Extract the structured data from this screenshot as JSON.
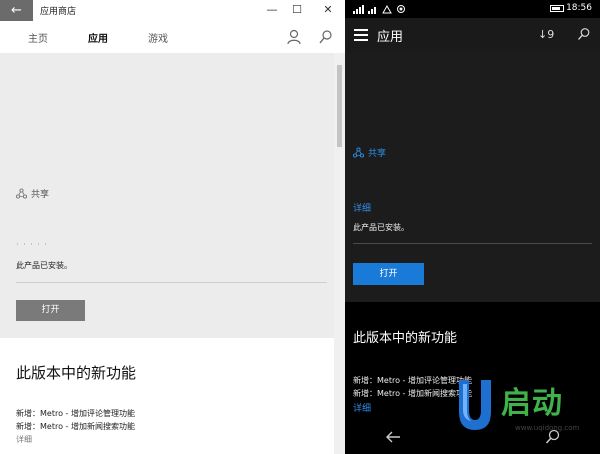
{
  "desktop": {
    "window_title": "应用商店",
    "controls": {
      "minimize": "—",
      "maximize": "☐",
      "close": "✕"
    },
    "nav_tabs": [
      "主页",
      "应用",
      "游戏"
    ],
    "share_label": "共享",
    "dots": "· · · · ·",
    "installed_text": "此产品已安装。",
    "open_button": "打开",
    "whats_new_heading": "此版本中的新功能",
    "notes": [
      "新增：Metro - 增加评论管理功能",
      "新增：Metro - 增加新闻搜索功能"
    ],
    "more_label": "详细"
  },
  "phone": {
    "status_time": "18:56",
    "app_title": "应用",
    "download_count": "↓9",
    "share_label": "共享",
    "details_label": "详细",
    "installed_text": "此产品已安装。",
    "open_button": "打开",
    "whats_new_heading": "此版本中的新功能",
    "notes": [
      "新增：Metro - 增加评论管理功能",
      "新增：Metro - 增加新闻搜索功能"
    ],
    "more_label": "详细"
  },
  "watermark": {
    "brand": "启动",
    "url": "www.uqidong.com"
  },
  "colors": {
    "accent_blue": "#1a7ad8",
    "link_blue": "#2e8ee8",
    "watermark_green": "#3fb24a"
  },
  "icons": [
    "back-arrow-icon",
    "user-icon",
    "search-icon",
    "share-icon",
    "menu-icon",
    "download-icon",
    "signal-icon",
    "wifi-icon",
    "battery-icon"
  ]
}
